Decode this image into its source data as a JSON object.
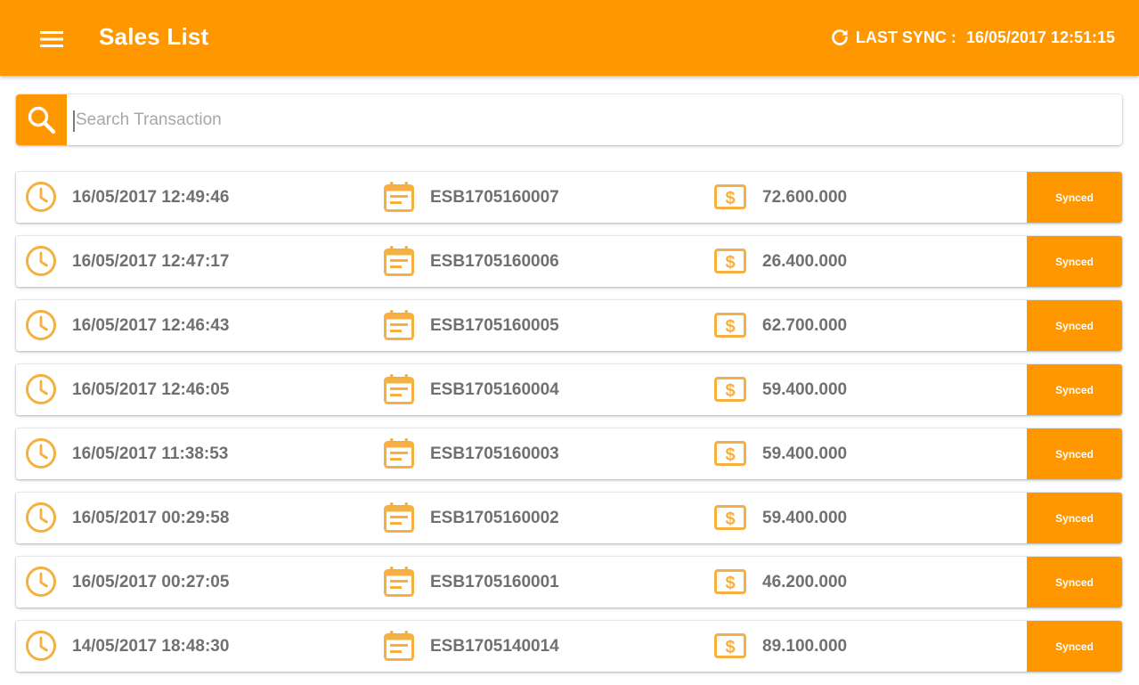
{
  "appbar": {
    "title": "Sales List",
    "menu_icon": "hamburger-menu-icon",
    "sync_icon": "refresh-icon",
    "last_sync_label": "LAST SYNC :",
    "last_sync_value": "16/05/2017 12:51:15"
  },
  "search": {
    "icon": "search-icon",
    "placeholder": "Search Transaction",
    "value": ""
  },
  "colors": {
    "accent": "#ff9800",
    "icon": "#f5b041",
    "text": "#707070"
  },
  "transactions": [
    {
      "datetime": "16/05/2017 12:49:46",
      "code": "ESB1705160007",
      "amount": "72.600.000",
      "status": "Synced"
    },
    {
      "datetime": "16/05/2017 12:47:17",
      "code": "ESB1705160006",
      "amount": "26.400.000",
      "status": "Synced"
    },
    {
      "datetime": "16/05/2017 12:46:43",
      "code": "ESB1705160005",
      "amount": "62.700.000",
      "status": "Synced"
    },
    {
      "datetime": "16/05/2017 12:46:05",
      "code": "ESB1705160004",
      "amount": "59.400.000",
      "status": "Synced"
    },
    {
      "datetime": "16/05/2017 11:38:53",
      "code": "ESB1705160003",
      "amount": "59.400.000",
      "status": "Synced"
    },
    {
      "datetime": "16/05/2017 00:29:58",
      "code": "ESB1705160002",
      "amount": "59.400.000",
      "status": "Synced"
    },
    {
      "datetime": "16/05/2017 00:27:05",
      "code": "ESB1705160001",
      "amount": "46.200.000",
      "status": "Synced"
    },
    {
      "datetime": "14/05/2017 18:48:30",
      "code": "ESB1705140014",
      "amount": "89.100.000",
      "status": "Synced"
    }
  ]
}
